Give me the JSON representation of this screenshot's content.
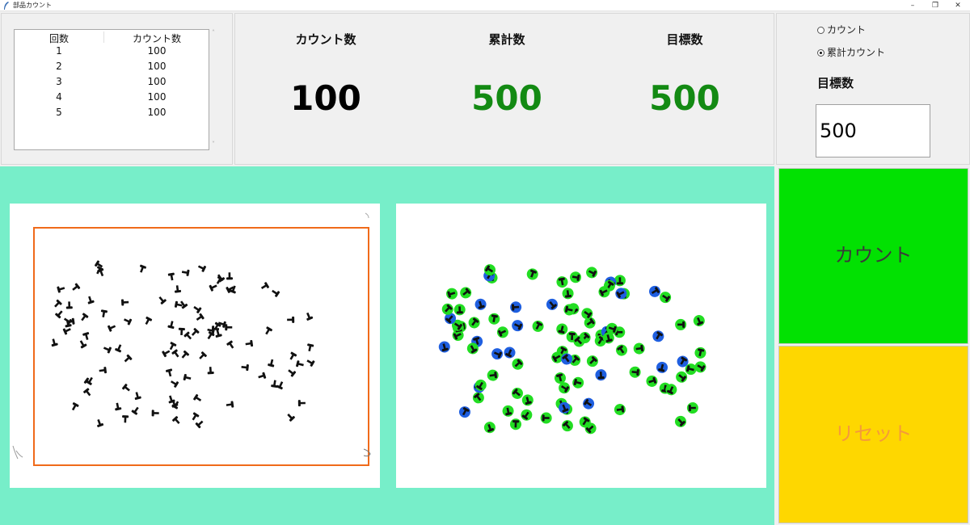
{
  "window": {
    "title": "部品カウント",
    "minimize": "–",
    "maximize": "❐",
    "close": "✕"
  },
  "table": {
    "headers": [
      "回数",
      "カウント数"
    ],
    "rows": [
      [
        "1",
        "100"
      ],
      [
        "2",
        "100"
      ],
      [
        "3",
        "100"
      ],
      [
        "4",
        "100"
      ],
      [
        "5",
        "100"
      ]
    ]
  },
  "stats": {
    "count_label": "カウント数",
    "count_value": "100",
    "total_label": "累計数",
    "total_value": "500",
    "target_label": "目標数",
    "target_value": "500"
  },
  "settings": {
    "radio_count": "カウント",
    "radio_cumulative": "累計カウント",
    "selected_mode": "累計カウント",
    "target_label": "目標数",
    "target_input_value": "500"
  },
  "buttons": {
    "count": "カウント",
    "reset": "リセット"
  },
  "colors": {
    "workarea_bg": "#77eec9",
    "count_button": "#02e102",
    "reset_button": "#fed700",
    "value_green": "#138a13",
    "roi_frame": "#f06a1a",
    "detect_single": "#22dd22",
    "detect_cluster": "#1f5fe0"
  },
  "icons": {
    "app": "feather-icon",
    "scroll_up": "chevron-up-icon",
    "scroll_down": "chevron-down-icon"
  }
}
